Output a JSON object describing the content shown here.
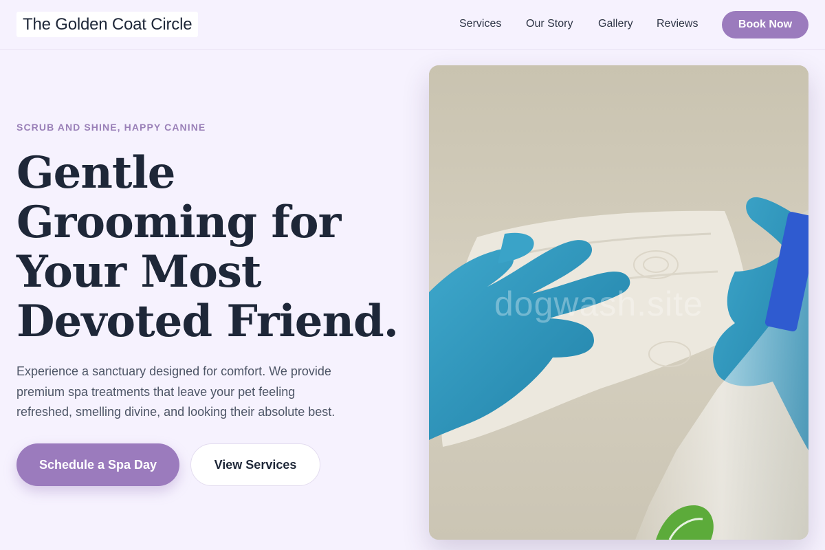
{
  "brand": {
    "name": "The Golden Coat Circle"
  },
  "nav": {
    "items": [
      {
        "label": "Services"
      },
      {
        "label": "Our Story"
      },
      {
        "label": "Gallery"
      },
      {
        "label": "Reviews"
      }
    ],
    "cta_label": "Book Now"
  },
  "hero": {
    "eyebrow": "SCRUB AND SHINE, HAPPY CANINE",
    "headline_lines": [
      "Gentle",
      "Grooming for",
      "Your Most",
      "Devoted Friend."
    ],
    "body_lines": [
      "Experience a sanctuary designed for comfort. We provide",
      "premium spa treatments that leave your pet feeling",
      "refreshed, smelling divine, and looking their absolute best."
    ],
    "primary_cta": "Schedule a Spa Day",
    "secondary_cta": "View Services",
    "image_watermark": "dogwash.site"
  },
  "colors": {
    "background": "#f6f2fe",
    "accent": "#9b7bbd",
    "heading": "#1e2738",
    "eyebrow": "#9a80b8",
    "body_text": "#4d5566"
  },
  "icons": {}
}
